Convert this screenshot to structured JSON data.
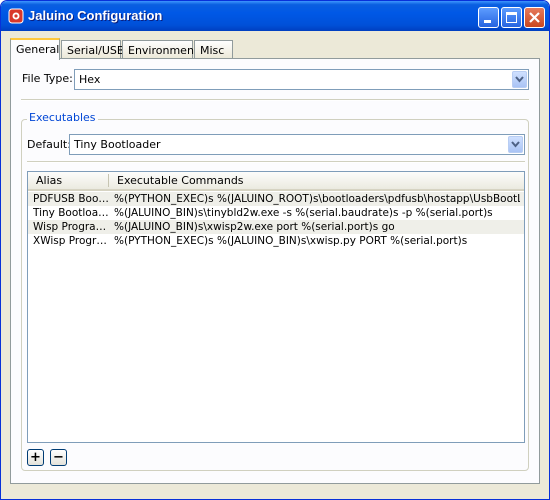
{
  "window": {
    "title": "Jaluino Configuration",
    "title_bar_color": "#0054e3",
    "icons": {
      "app": "jaluino-app-icon",
      "minimize": "minimize-icon",
      "maximize": "maximize-icon",
      "close": "close-icon"
    }
  },
  "tabs": [
    {
      "label": "General",
      "active": true
    },
    {
      "label": "Serial/USB",
      "active": false
    },
    {
      "label": "Environment",
      "active": false
    },
    {
      "label": "Misc",
      "active": false
    }
  ],
  "general": {
    "file_type_label": "File Type:",
    "file_type_value": "Hex"
  },
  "executables": {
    "group_title": "Executables",
    "default_label": "Default:",
    "default_value": "Tiny Bootloader",
    "columns": [
      "Alias",
      "Executable Commands"
    ],
    "rows": [
      {
        "alias": "PDFUSB Boo…",
        "command": "%(PYTHON_EXEC)s %(JALUINO_ROOT)s\\bootloaders\\pdfusb\\hostapp\\UsbBootL…"
      },
      {
        "alias": "Tiny Bootloa…",
        "command": "%(JALUINO_BIN)s\\tinybld2w.exe -s %(serial.baudrate)s -p %(serial.port)s"
      },
      {
        "alias": "Wisp Progra…",
        "command": "%(JALUINO_BIN)s\\xwisp2w.exe port %(serial.port)s go"
      },
      {
        "alias": "XWisp Progr…",
        "command": "%(PYTHON_EXEC)s %(JALUINO_BIN)s\\xwisp.py PORT %(serial.port)s"
      }
    ],
    "add_label": "+",
    "remove_label": "−"
  }
}
